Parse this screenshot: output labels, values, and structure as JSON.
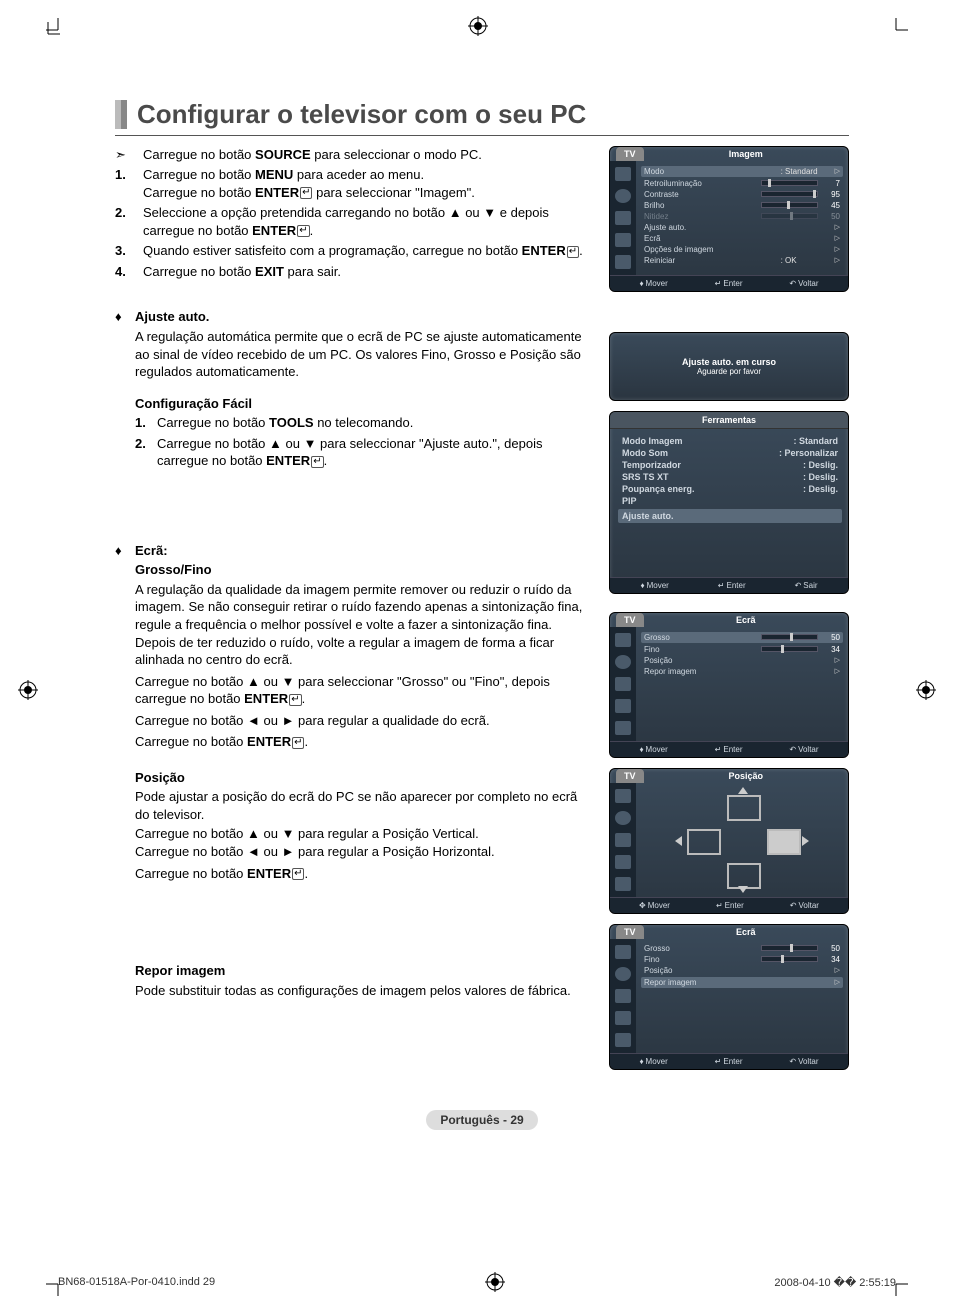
{
  "page": {
    "title": "Configurar o televisor com o seu PC",
    "arrow_intro": "Carregue no botão SOURCE para seleccionar o modo PC.",
    "steps": [
      "Carregue no botão MENU para aceder ao menu.",
      "Carregue no botão ENTER  para seleccionar \"Imagem\".",
      "Seleccione a opção pretendida carregando no botão ▲ ou ▼ e depois carregue no botão ENTER .",
      "Quando estiver satisfeito com a programação, carregue no botão ENTER .",
      "Carregue no botão EXIT para sair."
    ],
    "ajuste_auto": {
      "heading": "Ajuste auto.",
      "body": "A regulação automática permite que o ecrã de PC se ajuste automaticamente ao sinal de vídeo recebido de um PC. Os valores Fino, Grosso e Posição são regulados automaticamente."
    },
    "config_facil": {
      "heading": "Configuração Fácil",
      "step1": "Carregue no botão TOOLS no telecomando.",
      "step2": "Carregue no botão ▲ ou ▼ para seleccionar \"Ajuste auto.\", depois carregue no botão ENTER ."
    },
    "ecra": {
      "heading": "Ecrã:",
      "sub1": "Grosso/Fino",
      "body1a": "A regulação da qualidade da imagem permite remover ou reduzir o ruído da imagem. Se não conseguir retirar o ruído fazendo apenas a sintonização fina, regule a frequência o melhor possível e volte a fazer a sintonização fina. Depois de ter reduzido o ruído, volte a regular a imagem de forma a ficar alinhada no centro do ecrã.",
      "body1b": "Carregue no botão ▲ ou ▼ para seleccionar \"Grosso\" ou \"Fino\", depois carregue no botão ENTER .",
      "body1c": "Carregue no botão ◄ ou ► para regular a qualidade do ecrã.",
      "body1d": "Carregue no botão ENTER .",
      "sub2": "Posição",
      "body2a": "Pode ajustar a posição do ecrã do PC se não aparecer por completo no ecrã do televisor.",
      "body2b": "Carregue no botão ▲ ou ▼ para regular a Posição Vertical.",
      "body2c": "Carregue no botão ◄ ou ► para regular a Posição Horizontal.",
      "body2d": "Carregue no botão ENTER .",
      "sub3": "Repor imagem",
      "body3": "Pode substituir todas as configurações de imagem pelos valores de fábrica."
    },
    "footer_label": "Português - 29",
    "doc_meta_left": "BN68-01518A-Por-0410.indd   29",
    "doc_meta_right": "2008-04-10   �� 2:55:19"
  },
  "osd1": {
    "tv": "TV",
    "title": "Imagem",
    "rows": {
      "modo": {
        "label": "Modo",
        "val": ": Standard"
      },
      "retro": {
        "label": "Retroiluminação",
        "val": "7"
      },
      "contraste": {
        "label": "Contraste",
        "val": "95"
      },
      "brilho": {
        "label": "Brilho",
        "val": "45"
      },
      "nitidez": {
        "label": "Nitidez",
        "val": "50"
      },
      "ajuste": {
        "label": "Ajuste auto."
      },
      "ecra": {
        "label": "Ecrã"
      },
      "opcoes": {
        "label": "Opções de imagem"
      },
      "reiniciar": {
        "label": "Reiniciar",
        "val": ": OK"
      }
    },
    "footer": {
      "move": "Mover",
      "enter": "Enter",
      "back": "Voltar"
    }
  },
  "osd_auto": {
    "line1": "Ajuste auto. em curso",
    "line2": "Aguarde por favor"
  },
  "osd_tools": {
    "title": "Ferramentas",
    "rows": {
      "modo_img": {
        "label": "Modo Imagem",
        "val": ": Standard"
      },
      "modo_som": {
        "label": "Modo Som",
        "val": ": Personalizar"
      },
      "temp": {
        "label": "Temporizador",
        "val": ": Deslig."
      },
      "srs": {
        "label": "SRS TS XT",
        "val": ": Deslig."
      },
      "poup": {
        "label": "Poupança energ.",
        "val": ": Deslig."
      },
      "pip": {
        "label": "PIP",
        "val": ""
      },
      "ajuste": {
        "label": "Ajuste auto."
      }
    },
    "footer": {
      "move": "Mover",
      "enter": "Enter",
      "exit": "Sair"
    }
  },
  "osd_ecra1": {
    "tv": "TV",
    "title": "Ecrã",
    "rows": {
      "grosso": {
        "label": "Grosso",
        "val": "50"
      },
      "fino": {
        "label": "Fino",
        "val": "34"
      },
      "posicao": {
        "label": "Posição"
      },
      "repor": {
        "label": "Repor imagem"
      }
    },
    "footer": {
      "move": "Mover",
      "enter": "Enter",
      "back": "Voltar"
    }
  },
  "osd_pos": {
    "tv": "TV",
    "title": "Posição",
    "footer": {
      "move": "Mover",
      "enter": "Enter",
      "back": "Voltar"
    }
  },
  "osd_ecra2": {
    "tv": "TV",
    "title": "Ecrã",
    "rows": {
      "grosso": {
        "label": "Grosso",
        "val": "50"
      },
      "fino": {
        "label": "Fino",
        "val": "34"
      },
      "posicao": {
        "label": "Posição"
      },
      "repor": {
        "label": "Repor imagem"
      }
    },
    "footer": {
      "move": "Mover",
      "enter": "Enter",
      "back": "Voltar"
    }
  }
}
